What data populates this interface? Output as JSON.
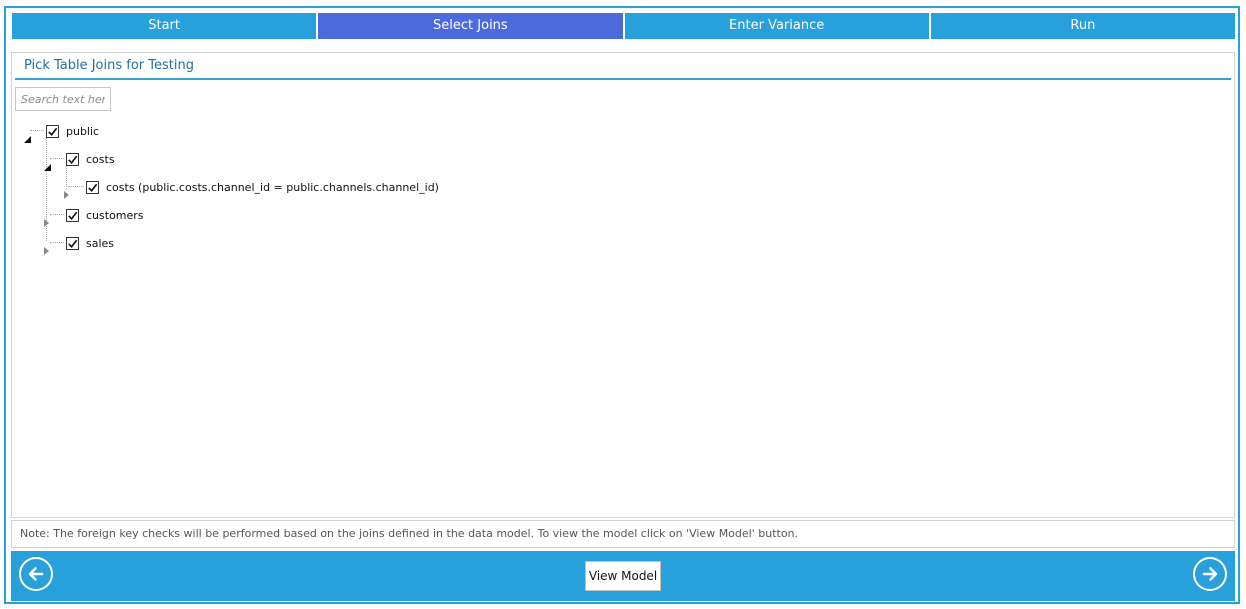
{
  "steps": [
    {
      "label": "Start",
      "active": false
    },
    {
      "label": "Select Joins",
      "active": true
    },
    {
      "label": "Enter Variance",
      "active": false
    },
    {
      "label": "Run",
      "active": false
    }
  ],
  "panel": {
    "title": "Pick Table Joins for Testing",
    "search_placeholder": "Search text here"
  },
  "tree": {
    "root": {
      "label": "public",
      "checked": true,
      "expanded": true
    },
    "costs": {
      "label": "costs",
      "checked": true,
      "expanded": true
    },
    "costs_join": {
      "label": "costs (public.costs.channel_id = public.channels.channel_id)",
      "checked": true,
      "expanded": false
    },
    "customers": {
      "label": "customers",
      "checked": true,
      "expanded": false
    },
    "sales": {
      "label": "sales",
      "checked": true,
      "expanded": false
    }
  },
  "note": "Note: The foreign key checks will be performed based on the joins defined in the data model. To view the model click on 'View Model' button.",
  "footer": {
    "view_model_label": "View Model",
    "back_icon": "arrow-left-circle-icon",
    "next_icon": "arrow-right-circle-icon"
  },
  "colors": {
    "accent": "#27a0db",
    "active_step": "#4b6bdd"
  }
}
